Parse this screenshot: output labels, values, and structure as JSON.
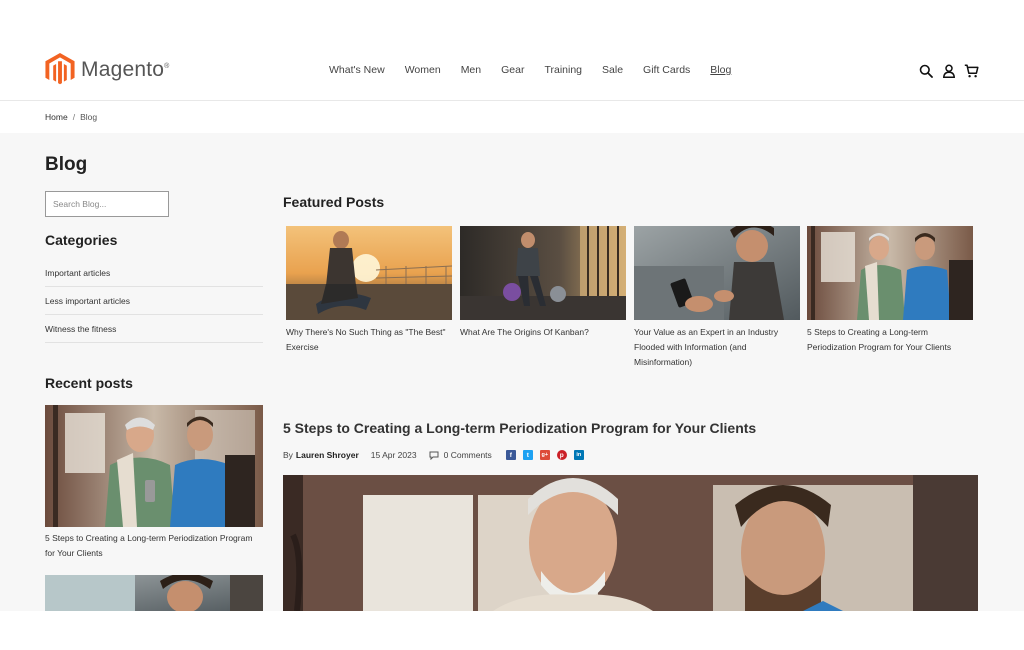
{
  "brand": {
    "name": "Magento",
    "trademark": "®",
    "accent": "#f26322"
  },
  "nav": {
    "items": [
      "What's New",
      "Women",
      "Men",
      "Gear",
      "Training",
      "Sale",
      "Gift Cards",
      "Blog"
    ],
    "active": "Blog"
  },
  "header_icons": [
    "search-icon",
    "account-icon",
    "cart-icon"
  ],
  "breadcrumb": {
    "home": "Home",
    "separator": "/",
    "current": "Blog"
  },
  "page": {
    "title": "Blog"
  },
  "search": {
    "placeholder": "Search Blog..."
  },
  "sidebar": {
    "categories_heading": "Categories",
    "categories": [
      "Important articles",
      "Less important articles",
      "Witness the fitness"
    ],
    "recent_heading": "Recent posts",
    "recent_posts": [
      {
        "title": "5 Steps to Creating a Long-term Periodization Program for Your Clients"
      }
    ]
  },
  "featured": {
    "heading": "Featured Posts",
    "posts": [
      {
        "title": "Why There's No Such Thing as \"The Best\" Exercise"
      },
      {
        "title": "What Are The Origins Of Kanban?"
      },
      {
        "title": "Your Value as an Expert in an Industry Flooded with Information (and Misinformation)"
      },
      {
        "title": "5 Steps to Creating a Long-term Periodization Program for Your Clients"
      }
    ]
  },
  "post": {
    "title": "5 Steps to Creating a Long-term Periodization Program for Your Clients",
    "by_label": "By",
    "author": "Lauren Shroyer",
    "date": "15 Apr 2023",
    "comments": "0 Comments",
    "share": [
      {
        "network": "facebook",
        "glyph": "f",
        "color": "#3b5998"
      },
      {
        "network": "twitter",
        "glyph": "t",
        "color": "#1da1f2"
      },
      {
        "network": "google-plus",
        "glyph": "g+",
        "color": "#dd4b39"
      },
      {
        "network": "pinterest",
        "glyph": "p",
        "color": "#cb2027"
      },
      {
        "network": "linkedin",
        "glyph": "in",
        "color": "#0077b5"
      }
    ]
  }
}
